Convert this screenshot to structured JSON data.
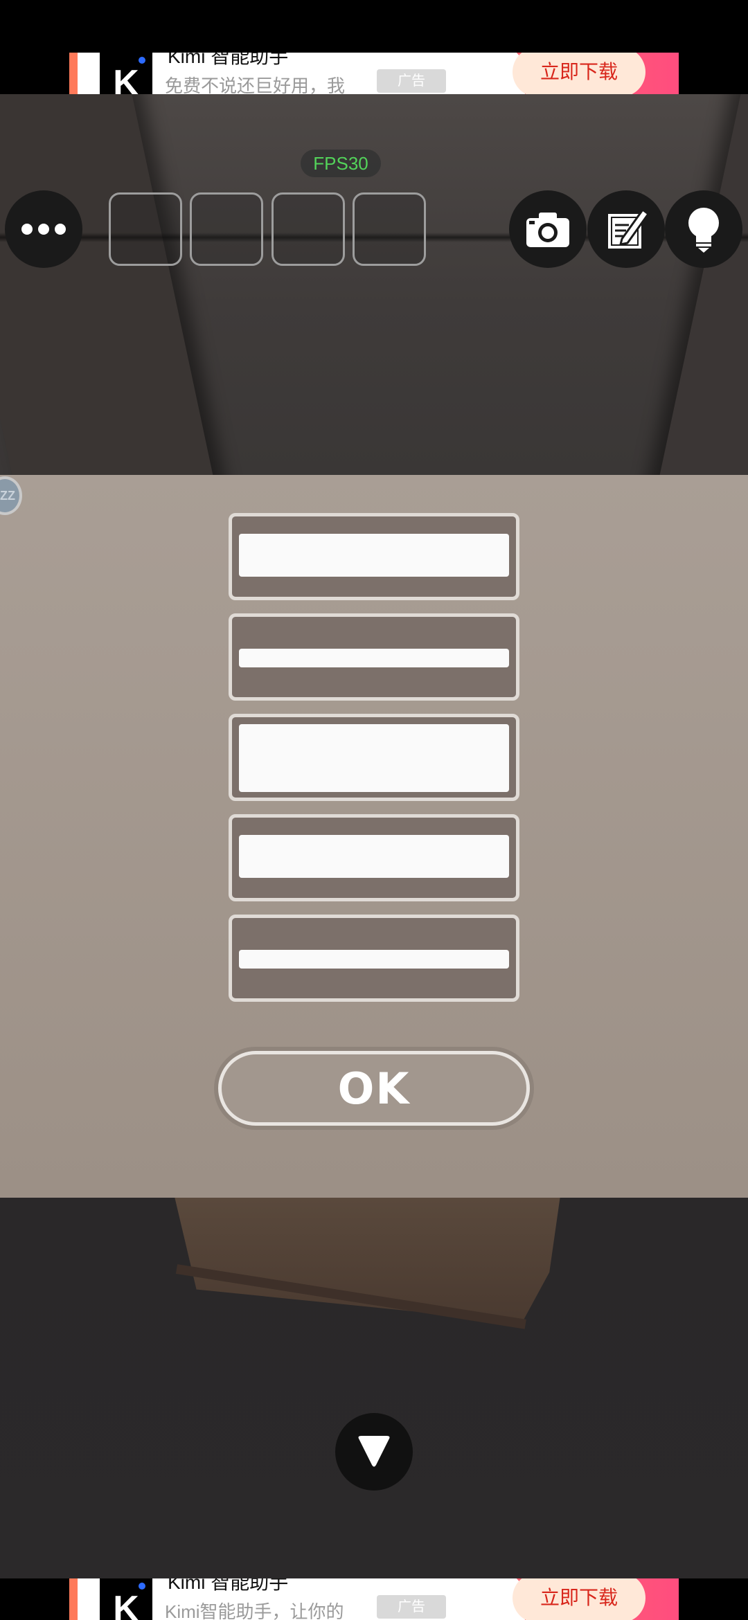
{
  "ads": {
    "top": {
      "title": "Kimi 智能助手",
      "subtitle": "免费不说还巨好用，我",
      "tag": "广告",
      "cta": "立即下载"
    },
    "bottom": {
      "title": "Kimi 智能助手",
      "subtitle": "Kimi智能助手，让你的",
      "tag": "广告",
      "cta": "立即下载"
    }
  },
  "hud": {
    "fps": "FPS30",
    "inventory_slots": 4,
    "icons": [
      "menu-icon",
      "camera-icon",
      "note-icon",
      "lightbulb-icon"
    ]
  },
  "puzzle": {
    "side_badge": "ZZ",
    "sliders": [
      {
        "level": "bar at middle-top",
        "fill": 0.62
      },
      {
        "level": "bar thin",
        "fill": 0.25
      },
      {
        "level": "bar tall",
        "fill": 0.95
      },
      {
        "level": "bar mid",
        "fill": 0.62
      },
      {
        "level": "bar thin lower",
        "fill": 0.25
      }
    ],
    "ok_label": "OK"
  },
  "nav": {
    "down_arrow": "down-arrow-icon"
  },
  "colors": {
    "panel": "#a0958c",
    "fps_text": "#53d35a",
    "ad_cta_text": "#d8261b"
  }
}
